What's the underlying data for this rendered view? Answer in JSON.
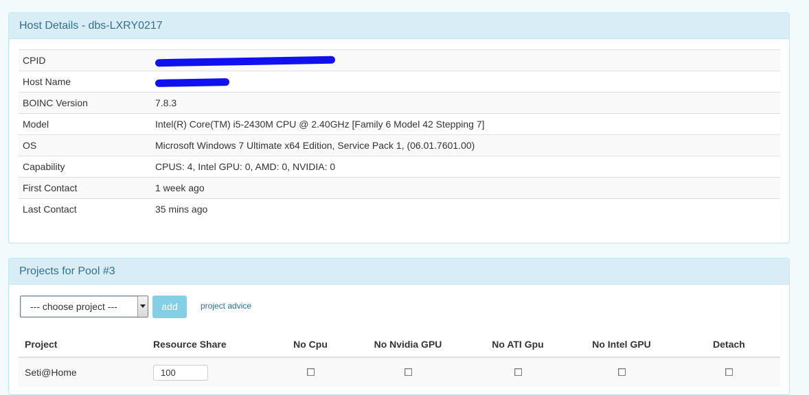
{
  "host_panel": {
    "title": "Host Details - dbs-LXRY0217",
    "rows": [
      {
        "label": "CPID",
        "value": ""
      },
      {
        "label": "Host Name",
        "value": ""
      },
      {
        "label": "BOINC Version",
        "value": "7.8.3"
      },
      {
        "label": "Model",
        "value": "Intel(R) Core(TM) i5-2430M CPU @ 2.40GHz [Family 6 Model 42 Stepping 7]"
      },
      {
        "label": "OS",
        "value": "Microsoft Windows 7 Ultimate x64 Edition, Service Pack 1, (06.01.7601.00)"
      },
      {
        "label": "Capability",
        "value": "CPUS: 4, Intel GPU: 0, AMD: 0, NVIDIA: 0"
      },
      {
        "label": "First Contact",
        "value": "1 week ago"
      },
      {
        "label": "Last Contact",
        "value": "35 mins ago"
      }
    ]
  },
  "projects_panel": {
    "title": "Projects for Pool #3",
    "select_value": "--- choose project ---",
    "add_label": "add",
    "advice_label": "project advice",
    "columns": [
      "Project",
      "Resource Share",
      "No Cpu",
      "No Nvidia GPU",
      "No ATI Gpu",
      "No Intel GPU",
      "Detach"
    ],
    "rows": [
      {
        "project": "Seti@Home",
        "resource_share": "100"
      }
    ]
  },
  "colors": {
    "accent": "#31708f",
    "heading_bg": "#d9edf7",
    "button": "#5bc0de",
    "redaction": "#1010f0"
  }
}
